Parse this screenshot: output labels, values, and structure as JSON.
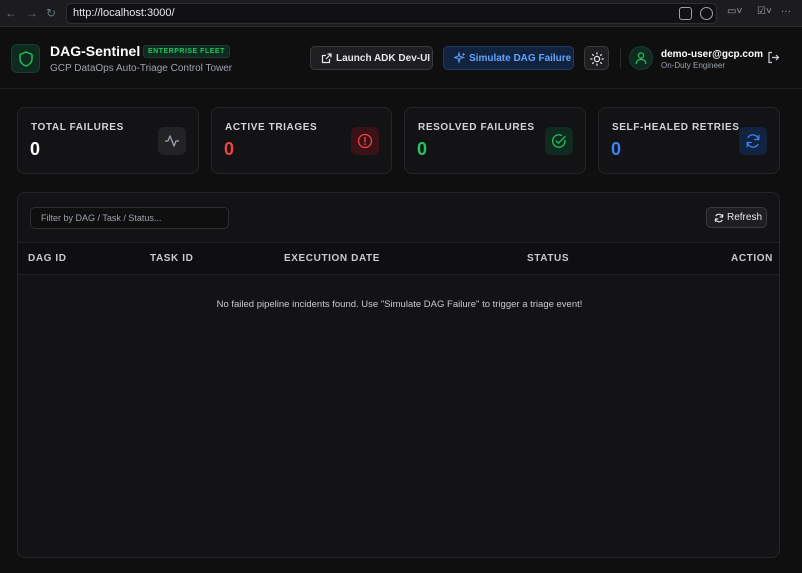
{
  "browser": {
    "url": "http://localhost:3000/"
  },
  "header": {
    "title": "DAG-Sentinel",
    "badge": "ENTERPRISE FLEET",
    "subtitle": "GCP DataOps Auto-Triage Control Tower",
    "launch_label": "Launch ADK Dev-UI",
    "simulate_label": "Simulate DAG Failure",
    "user_email": "demo-user@gcp.com",
    "user_role": "On-Duty Engineer"
  },
  "stats": [
    {
      "label": "TOTAL FAILURES",
      "value": "0",
      "color": "#ffffff",
      "icon": "activity-icon"
    },
    {
      "label": "ACTIVE TRIAGES",
      "value": "0",
      "color": "#ef4444",
      "icon": "alert-circle-icon"
    },
    {
      "label": "RESOLVED FAILURES",
      "value": "0",
      "color": "#22c55e",
      "icon": "check-circle-icon"
    },
    {
      "label": "SELF-HEALED RETRIES",
      "value": "0",
      "color": "#3b82f6",
      "icon": "refresh-icon"
    }
  ],
  "table": {
    "filter_placeholder": "Filter by DAG / Task / Status...",
    "refresh_label": "Refresh",
    "columns": [
      "DAG ID",
      "TASK ID",
      "EXECUTION DATE",
      "STATUS",
      "ACTION"
    ],
    "empty_message": "No failed pipeline incidents found. Use \"Simulate DAG Failure\" to trigger a triage event!"
  },
  "colors": {
    "accent_green": "#22c55e",
    "accent_blue": "#60a5fa",
    "accent_red": "#ef4444",
    "background": "#0f0f10"
  }
}
